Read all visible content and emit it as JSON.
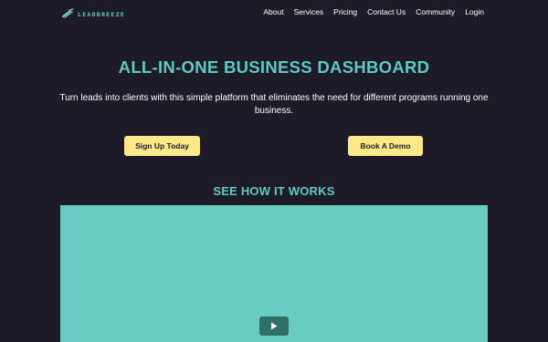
{
  "brand": {
    "logo_text": "LEADBREEZE",
    "logo_icon": "wind-swoosh-icon"
  },
  "nav": {
    "items": [
      {
        "label": "About"
      },
      {
        "label": "Services"
      },
      {
        "label": "Pricing"
      },
      {
        "label": "Contact Us"
      },
      {
        "label": "Community"
      },
      {
        "label": "Login"
      }
    ]
  },
  "hero": {
    "title": "ALL-IN-ONE BUSINESS DASHBOARD",
    "subtitle": "Turn leads into clients with this simple platform that eliminates the need for different programs running one business.",
    "signup_label": "Sign Up Today",
    "demo_label": "Book A Demo"
  },
  "video_section": {
    "heading": "SEE HOW IT WORKS",
    "play_icon": "play-icon"
  },
  "colors": {
    "background": "#1c1b27",
    "accent": "#5fc9c2",
    "button": "#fde98a",
    "video": "#68cbc4",
    "play_button": "#2e6f67"
  }
}
